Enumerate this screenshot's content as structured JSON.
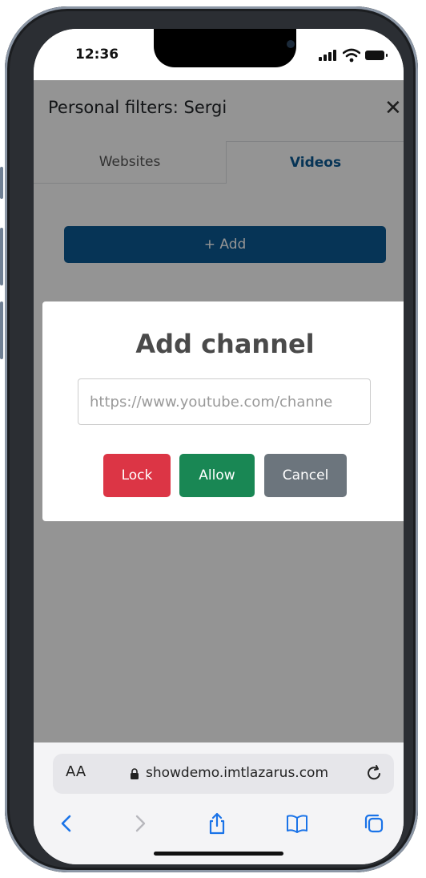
{
  "status_bar": {
    "time": "12:36"
  },
  "page": {
    "title": "Personal filters: Sergi",
    "tabs": [
      {
        "label": "Websites",
        "active": false
      },
      {
        "label": "Videos",
        "active": true
      }
    ],
    "add_button_label": "+ Add"
  },
  "modal": {
    "title": "Add channel",
    "input_placeholder": "https://www.youtube.com/channe",
    "buttons": {
      "lock": "Lock",
      "allow": "Allow",
      "cancel": "Cancel"
    }
  },
  "browser": {
    "aa_label": "AA",
    "url": "showdemo.imtlazarus.com"
  },
  "colors": {
    "primary": "#0b5a94",
    "danger": "#dc3545",
    "success": "#198754",
    "secondary": "#6c757d"
  }
}
